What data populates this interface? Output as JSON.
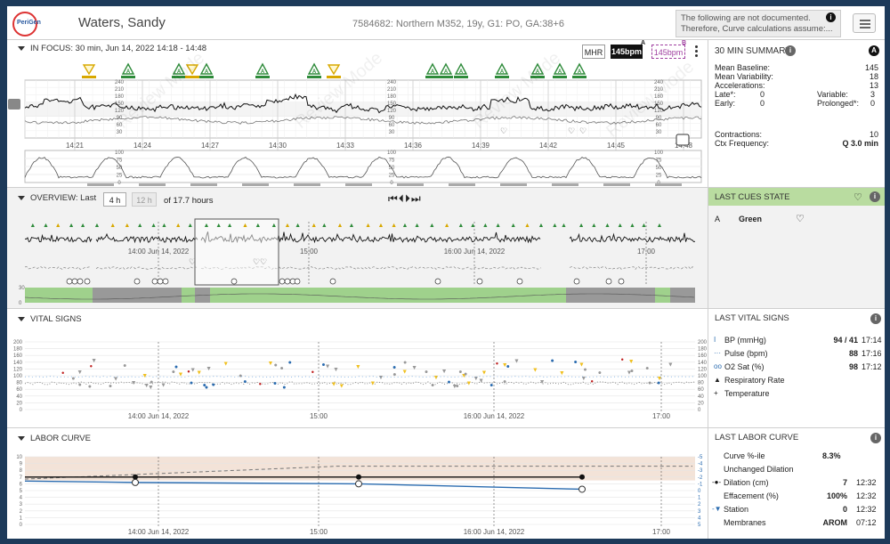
{
  "header": {
    "logo": "PeriGen",
    "patient_name": "Waters, Sandy",
    "patient_info": "7584682: Northern M352, 19y, G1: PO, GA:38+6",
    "notice_line1": "The following are not documented.",
    "notice_line2": "Therefore, Curve calculations assume:..."
  },
  "focus": {
    "title": "IN FOCUS: 30 min, Jun 14, 2022 14:18 - 14:48",
    "btn_mhr": "MHR",
    "btn_a": "145bpm",
    "btn_b": "145bpm",
    "tag_a": "A",
    "tag_b": "B",
    "fhr_scale": [
      "240",
      "210",
      "180",
      "150",
      "120",
      "90",
      "60",
      "30"
    ],
    "uc_scale": [
      "100",
      "75",
      "50",
      "25",
      "0"
    ],
    "time_labels": [
      "14:21",
      "14:24",
      "14:27",
      "14:30",
      "14:33",
      "14:36",
      "14:39",
      "14:42",
      "14:45",
      "14:48"
    ],
    "watermark": "Review Mode"
  },
  "summary": {
    "title": "30 MIN SUMMARY",
    "badge": "A",
    "rows": [
      {
        "label": "Mean Baseline:",
        "value": "145"
      },
      {
        "label": "Mean Variability:",
        "value": "18"
      },
      {
        "label": "Accelerations:",
        "value": "13"
      }
    ],
    "late_label": "Late*:",
    "late_value": "0",
    "variable_label": "Variable:",
    "variable_value": "3",
    "early_label": "Early:",
    "early_value": "0",
    "prolonged_label": "Prolonged*:",
    "prolonged_value": "0",
    "contractions_label": "Contractions:",
    "contractions_value": "10",
    "ctx_label": "Ctx Frequency:",
    "ctx_value": "Q 3.0 min"
  },
  "overview": {
    "title": "OVERVIEW: Last",
    "range_4h": "4 h",
    "range_12h": "12 h",
    "of_text": "of 17.7 hours",
    "nav": [
      "⏮",
      "⏴",
      "⏵",
      "⏭"
    ],
    "time_labels": [
      "14:00 Jun 14, 2022",
      "15:00",
      "16:00 Jun 14, 2022",
      "17:00"
    ],
    "scale_top": "30",
    "scale_bottom": "0"
  },
  "cues": {
    "title": "LAST CUES STATE",
    "letter": "A",
    "state": "Green",
    "accent": "#b9dca0"
  },
  "vitals": {
    "title": "VITAL SIGNS",
    "scale": [
      "200",
      "180",
      "160",
      "140",
      "120",
      "100",
      "80",
      "60",
      "40",
      "20",
      "0"
    ],
    "time_labels": [
      "14:00 Jun 14, 2022",
      "15:00",
      "16:00 Jun 14, 2022",
      "17:00"
    ],
    "panel_title": "LAST VITAL SIGNS",
    "rows": [
      {
        "label": "BP (mmHg)",
        "value": "94 / 41",
        "time": "17:14"
      },
      {
        "label": "Pulse (bpm)",
        "value": "88",
        "time": "17:16"
      },
      {
        "label": "O2 Sat (%)",
        "value": "98",
        "time": "17:12"
      },
      {
        "label": "Respiratory Rate",
        "value": "",
        "time": ""
      },
      {
        "label": "Temperature",
        "value": "",
        "time": ""
      }
    ]
  },
  "labor": {
    "title": "LABOR CURVE",
    "scale_left": [
      "10",
      "9",
      "8",
      "7",
      "6",
      "5",
      "4",
      "3",
      "2",
      "1",
      "0"
    ],
    "scale_right": [
      "-5",
      "-4",
      "-3",
      "-2",
      "-1",
      "0",
      "1",
      "2",
      "3",
      "4",
      "5"
    ],
    "time_labels": [
      "14:00 Jun 14, 2022",
      "15:00",
      "16:00 Jun 14, 2022",
      "17:00"
    ],
    "panel_title": "LAST LABOR CURVE",
    "curve_label": "Curve %-ile",
    "curve_value": "8.3%",
    "unchanged": "Unchanged Dilation",
    "rows": [
      {
        "label": "Dilation (cm)",
        "value": "7",
        "time": "12:32"
      },
      {
        "label": "Effacement (%)",
        "value": "100%",
        "time": "12:32"
      },
      {
        "label": "Station",
        "value": "0",
        "time": "12:32"
      },
      {
        "label": "Membranes",
        "value": "AROM",
        "time": "07:12"
      }
    ]
  },
  "colors": {
    "accel": "#2e8b3a",
    "deceleration": "#d8a800",
    "bp": "#2b6cb0",
    "pulse": "#888888",
    "o2": "#4a90d9",
    "labor_band": "#f3e3d8"
  }
}
